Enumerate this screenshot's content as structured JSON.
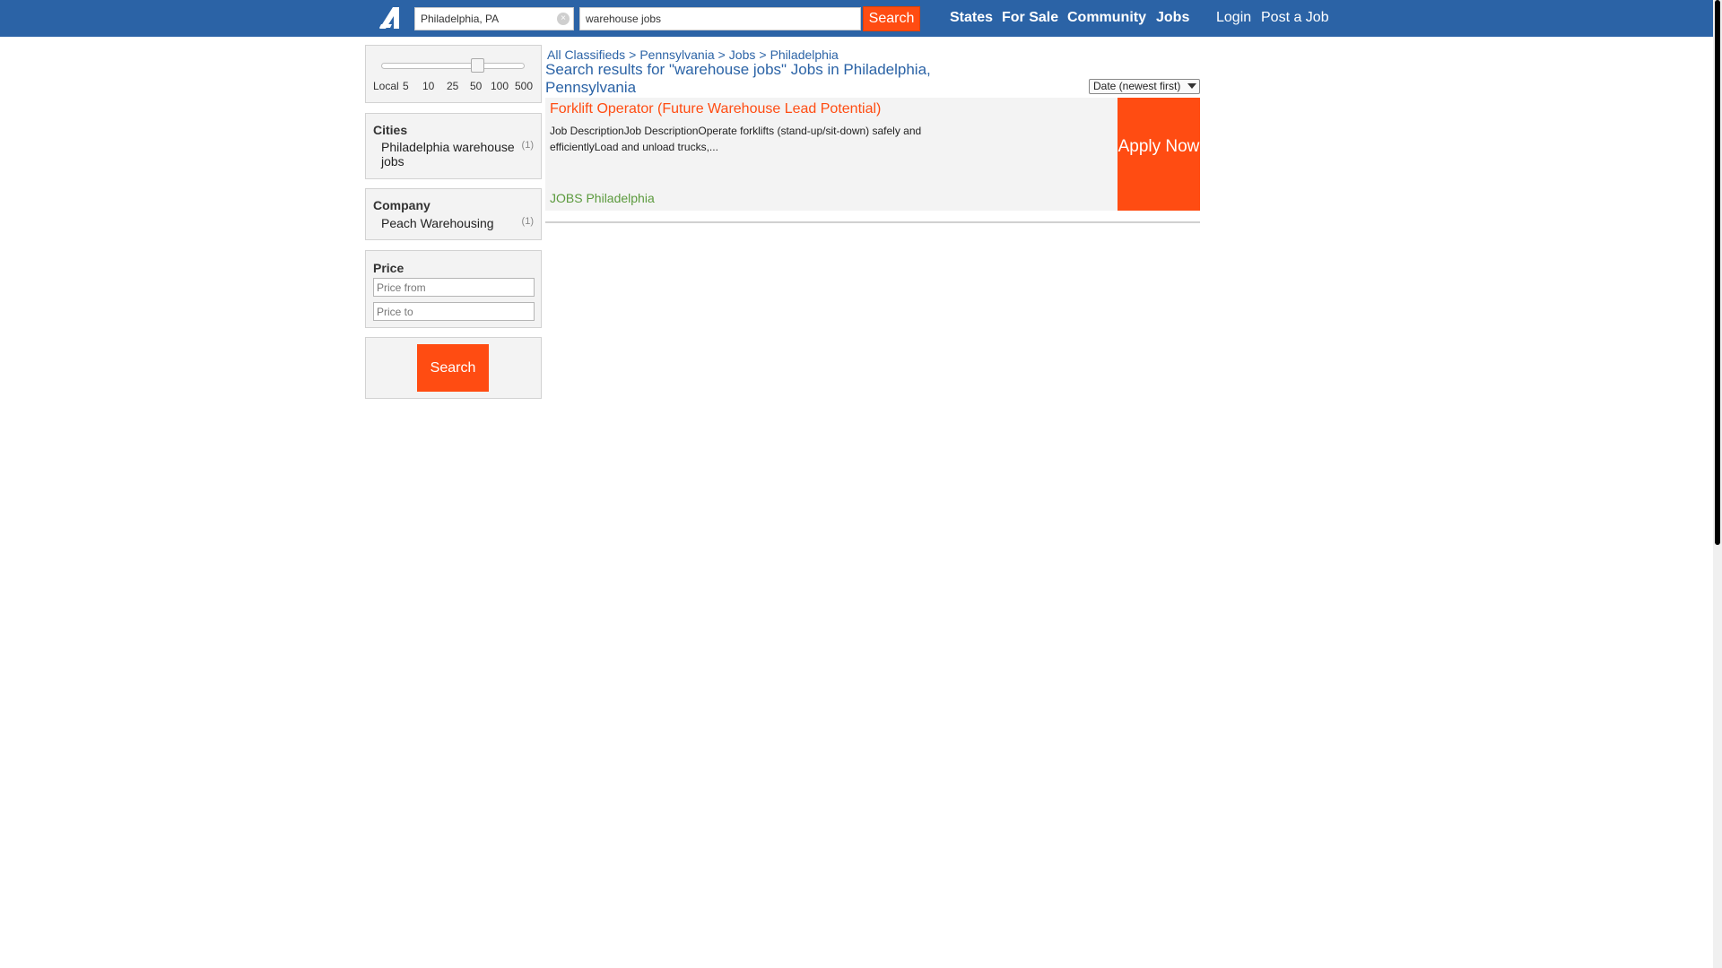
{
  "header": {
    "location_value": "Philadelphia, PA",
    "query_value": "warehouse jobs",
    "search_label": "Search",
    "nav": [
      "States",
      "For Sale",
      "Community",
      "Jobs"
    ],
    "login_label": "Login",
    "post_label": "Post a Job",
    "brand_color": "#2b63a6",
    "accent_color": "#ff4c12"
  },
  "sidebar": {
    "distance_ticks": [
      "Local",
      "5",
      "10",
      "25",
      "50",
      "100",
      "500"
    ],
    "distance_selected": "50",
    "cities": {
      "title": "Cities",
      "items": [
        {
          "label": "Philadelphia warehouse jobs",
          "count": "(1)"
        }
      ]
    },
    "company": {
      "title": "Company",
      "items": [
        {
          "label": "Peach Warehousing",
          "count": "(1)"
        }
      ]
    },
    "price": {
      "title": "Price",
      "from_placeholder": "Price from",
      "to_placeholder": "Price to"
    },
    "search_label": "Search"
  },
  "main": {
    "breadcrumbs": [
      "All Classifieds",
      "Pennsylvania",
      "Jobs",
      "Philadelphia"
    ],
    "results_title": "Search results for \"warehouse jobs\" Jobs in Philadelphia, Pennsylvania",
    "sort_selected": "Date (newest first)",
    "listings": [
      {
        "title": "Forklift Operator (Future Warehouse Lead Potential)",
        "description": "Job DescriptionJob DescriptionOperate forklifts (stand-up/sit-down) safely and efficientlyLoad and unload trucks,...",
        "meta": "JOBS Philadelphia",
        "apply_label": "Apply Now"
      }
    ]
  }
}
